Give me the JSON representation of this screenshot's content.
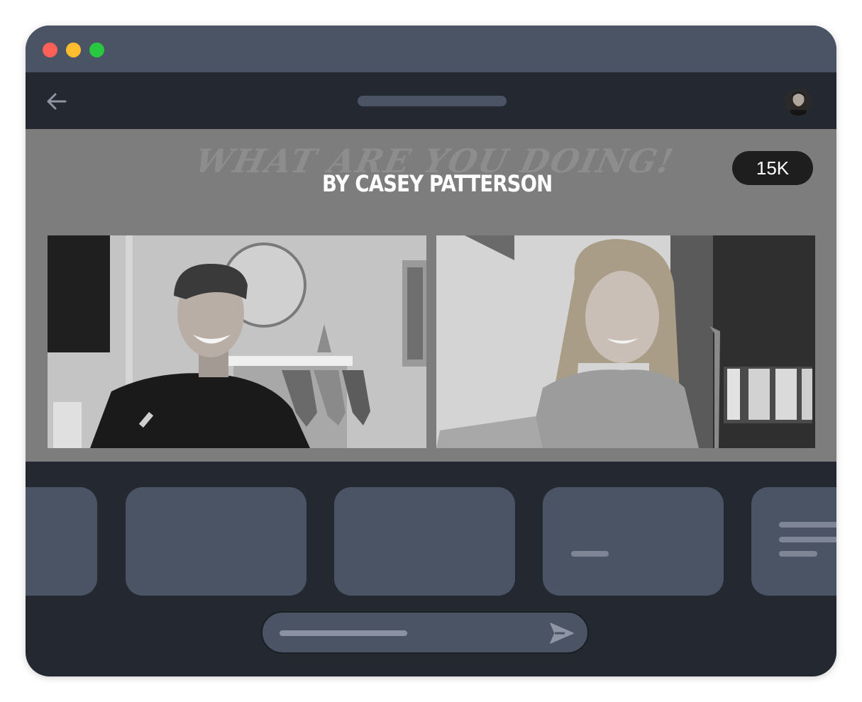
{
  "window": {
    "controls": [
      "close",
      "minimize",
      "zoom"
    ],
    "colors": {
      "close": "#fe5f57",
      "minimize": "#febc2e",
      "zoom": "#28c840"
    }
  },
  "navbar": {
    "back_icon": "arrow-left-icon",
    "avatar": "user-avatar"
  },
  "video": {
    "title": "BY CASEY PATTERSON",
    "background_text": "WHAT ARE YOU DOING!",
    "viewer_count": "15K"
  },
  "composer": {
    "send_icon": "paper-plane-icon"
  }
}
